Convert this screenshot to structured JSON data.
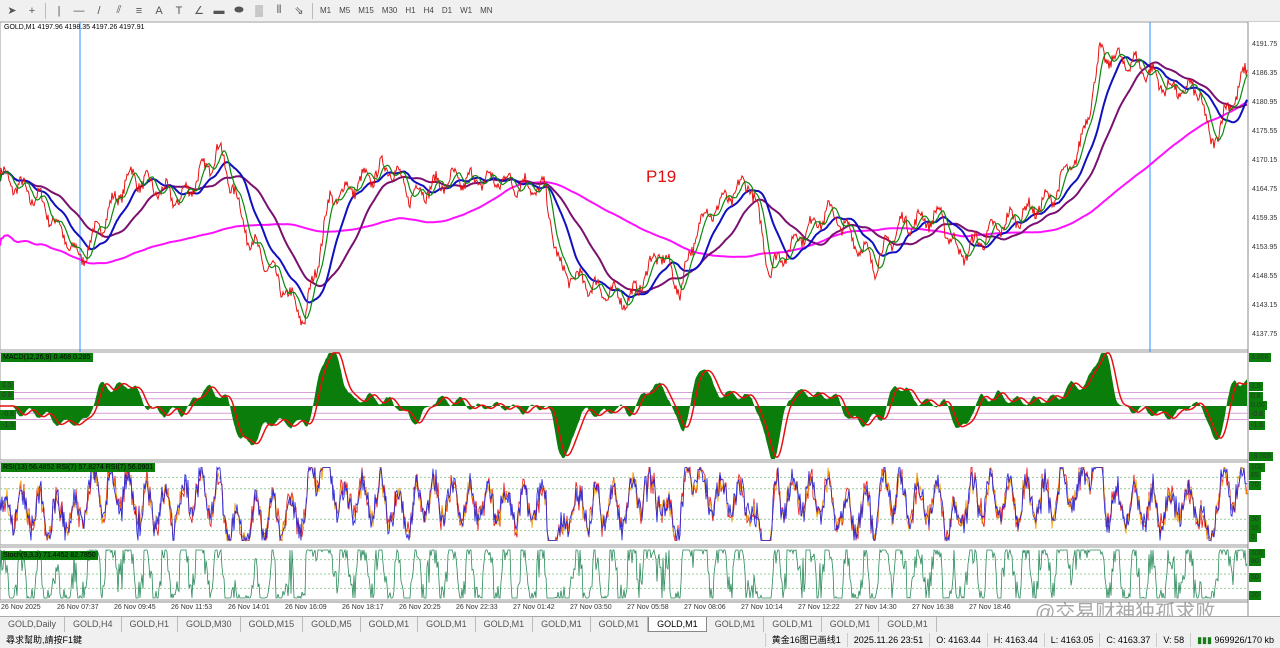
{
  "toolbar": {
    "tools": [
      "cursor",
      "crosshair",
      "vertical-line",
      "horizontal-line",
      "trend-line",
      "fibonacci",
      "channel",
      "text",
      "text-label",
      "gann",
      "rectangle",
      "ellipse",
      "pattern",
      "cycles",
      "arrows"
    ],
    "timeframes": [
      "M1",
      "M5",
      "M15",
      "M30",
      "H1",
      "H4",
      "D1",
      "W1",
      "MN"
    ]
  },
  "chart": {
    "title": "GOLD,M1  4197.96 4198.35 4197.26 4197.91",
    "annotation": "P19",
    "price_labels": [
      "4191.75",
      "4186.35",
      "4180.95",
      "4175.55",
      "4170.15",
      "4164.75",
      "4159.35",
      "4153.95",
      "4148.55",
      "4143.15",
      "4137.75"
    ],
    "macd": {
      "title": "MACD(12,26,9) 0.468 0.285",
      "left_levels": [
        "1.5",
        "0.8",
        "-0.8",
        "-1.5"
      ],
      "right_labels": [
        "3.858",
        "1.5",
        "0.8",
        "0.00",
        "-0.8",
        "-1.5",
        "-3.765"
      ]
    },
    "rsi": {
      "title": "RSI(13) 56.4852  RSI(7) 57.8274  RSI(7) 56.0901",
      "right_labels": [
        "100",
        "85",
        "70",
        "30",
        "15",
        "0"
      ]
    },
    "stoch": {
      "title": "Stoch(9,3,3) 71.4452 82.7850",
      "right_labels": [
        "100",
        "80",
        "50",
        "20"
      ]
    },
    "time_labels": [
      "26 Nov 2025",
      "26 Nov 07:37",
      "26 Nov 09:45",
      "26 Nov 11:53",
      "26 Nov 14:01",
      "26 Nov 16:09",
      "26 Nov 18:17",
      "26 Nov 20:25",
      "26 Nov 22:33",
      "27 Nov 01:42",
      "27 Nov 03:50",
      "27 Nov 05:58",
      "27 Nov 08:06",
      "27 Nov 10:14",
      "27 Nov 12:22",
      "27 Nov 14:30",
      "27 Nov 16:38",
      "27 Nov 18:46"
    ]
  },
  "chart_data": {
    "type": "line",
    "symbol": "GOLD,M1",
    "ylim": [
      4134,
      4195
    ],
    "price_keypoints": [
      [
        0,
        4167.5
      ],
      [
        40,
        4162.9
      ],
      [
        80,
        4151.7
      ],
      [
        130,
        4167.5
      ],
      [
        180,
        4162.9
      ],
      [
        220,
        4172.2
      ],
      [
        250,
        4155.4
      ],
      [
        305,
        4140.6
      ],
      [
        330,
        4162.9
      ],
      [
        390,
        4169.4
      ],
      [
        410,
        4163.8
      ],
      [
        450,
        4166.6
      ],
      [
        500,
        4166.6
      ],
      [
        545,
        4164.7
      ],
      [
        560,
        4149.8
      ],
      [
        600,
        4146.1
      ],
      [
        630,
        4144.2
      ],
      [
        660,
        4153.5
      ],
      [
        680,
        4146.1
      ],
      [
        700,
        4159.1
      ],
      [
        750,
        4166.6
      ],
      [
        770,
        4149.8
      ],
      [
        800,
        4156.3
      ],
      [
        830,
        4161.0
      ],
      [
        875,
        4150.8
      ],
      [
        900,
        4158.2
      ],
      [
        940,
        4160.0
      ],
      [
        960,
        4152.6
      ],
      [
        1000,
        4158.2
      ],
      [
        1050,
        4162.9
      ],
      [
        1080,
        4172.2
      ],
      [
        1100,
        4189.9
      ],
      [
        1140,
        4188.0
      ],
      [
        1170,
        4183.4
      ],
      [
        1200,
        4183.4
      ],
      [
        1210,
        4173.1
      ],
      [
        1245,
        4186.1
      ]
    ],
    "ma_periods": [
      10,
      30,
      60,
      200
    ],
    "colors": {
      "price": "#e81010",
      "ma_fast": "#0a8a0a",
      "ma_blue": "#1010c0",
      "ma_purple": "#7a1070",
      "ma_magenta": "#ff10ff"
    }
  },
  "tabs": [
    "GOLD,Daily",
    "GOLD,H4",
    "GOLD,H1",
    "GOLD,M30",
    "GOLD,M15",
    "GOLD,M5",
    "GOLD,M1",
    "GOLD,M1",
    "GOLD,M1",
    "GOLD,M1",
    "GOLD,M1",
    "GOLD,M1",
    "GOLD,M1",
    "GOLD,M1",
    "GOLD,M1",
    "GOLD,M1"
  ],
  "active_tab": 11,
  "status": {
    "help": "尋求幫助,請按F1鍵",
    "profile": "黄金16图已画线1",
    "datetime": "2025.11.26 23:51",
    "open": "O: 4163.44",
    "high": "H: 4163.44",
    "low": "L: 4163.05",
    "close": "C: 4163.37",
    "volume": "V: 58",
    "traffic": "969926/170 kb"
  },
  "watermark": "@交易财神独孤求败"
}
